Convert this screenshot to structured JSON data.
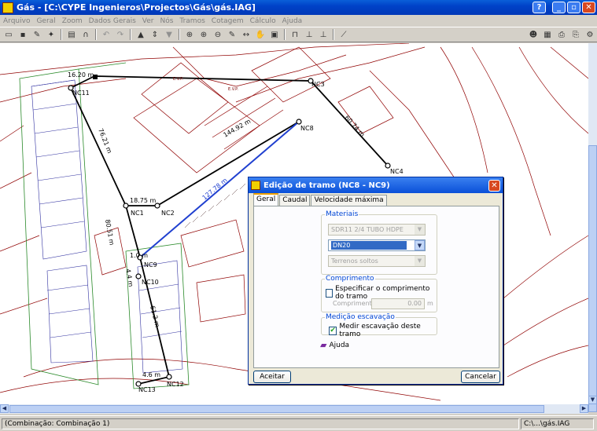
{
  "window": {
    "title": "Gás - [C:\\CYPE Ingenieros\\Projectos\\Gás\\gás.IAG]",
    "help_btn": "?",
    "min_btn": "_",
    "max_btn": "▫",
    "close_btn": "✕"
  },
  "menu": [
    "Arquivo",
    "Geral",
    "Zoom",
    "Dados Gerais",
    "Ver",
    "Nós",
    "Tramos",
    "Cotagem",
    "Cálculo",
    "Ajuda"
  ],
  "map": {
    "nodes": [
      "NC1",
      "NC2",
      "NC3",
      "NC4",
      "NC8",
      "NC9",
      "NC10",
      "NC11",
      "NC12",
      "NC13"
    ],
    "dims": [
      "16.20 m",
      "18.75 m",
      "144.92 m",
      "127.78 m",
      "60.74 m",
      "76.21 m",
      "61.2 m",
      "4.6 m",
      "80.51 m",
      "4.4 m",
      "1.0 m"
    ],
    "labels": [
      "E.V.P.",
      "E.V.P."
    ]
  },
  "dialog": {
    "title": "Edição de tramo (NC8 - NC9)",
    "close": "✕",
    "tabs": [
      "Geral",
      "Caudal",
      "Velocidade máxima"
    ],
    "materiais": {
      "legend": "Materiais",
      "material": "SDR11 2/4 TUBO HDPE",
      "diameter": "DN20",
      "terrain": "Terrenos soltos"
    },
    "comprimento": {
      "legend": "Comprimento",
      "check_label": "Especificar o comprimento do tramo",
      "checked": false,
      "field_label": "Comprimento",
      "value": "0.00",
      "unit": "m"
    },
    "medicao": {
      "legend": "Medição escavação",
      "check_label": "Medir escavação deste tramo",
      "checked": true
    },
    "help": "Ajuda",
    "ok": "Aceitar",
    "cancel": "Cancelar"
  },
  "status": {
    "left": "(Combinação: Combinação 1)",
    "right": "C:\\...\\gás.IAG"
  },
  "colors": {
    "accent": "#0a50d8",
    "pipe_selected": "#2040d0",
    "map_lines": "#800000",
    "network": "#000000"
  }
}
